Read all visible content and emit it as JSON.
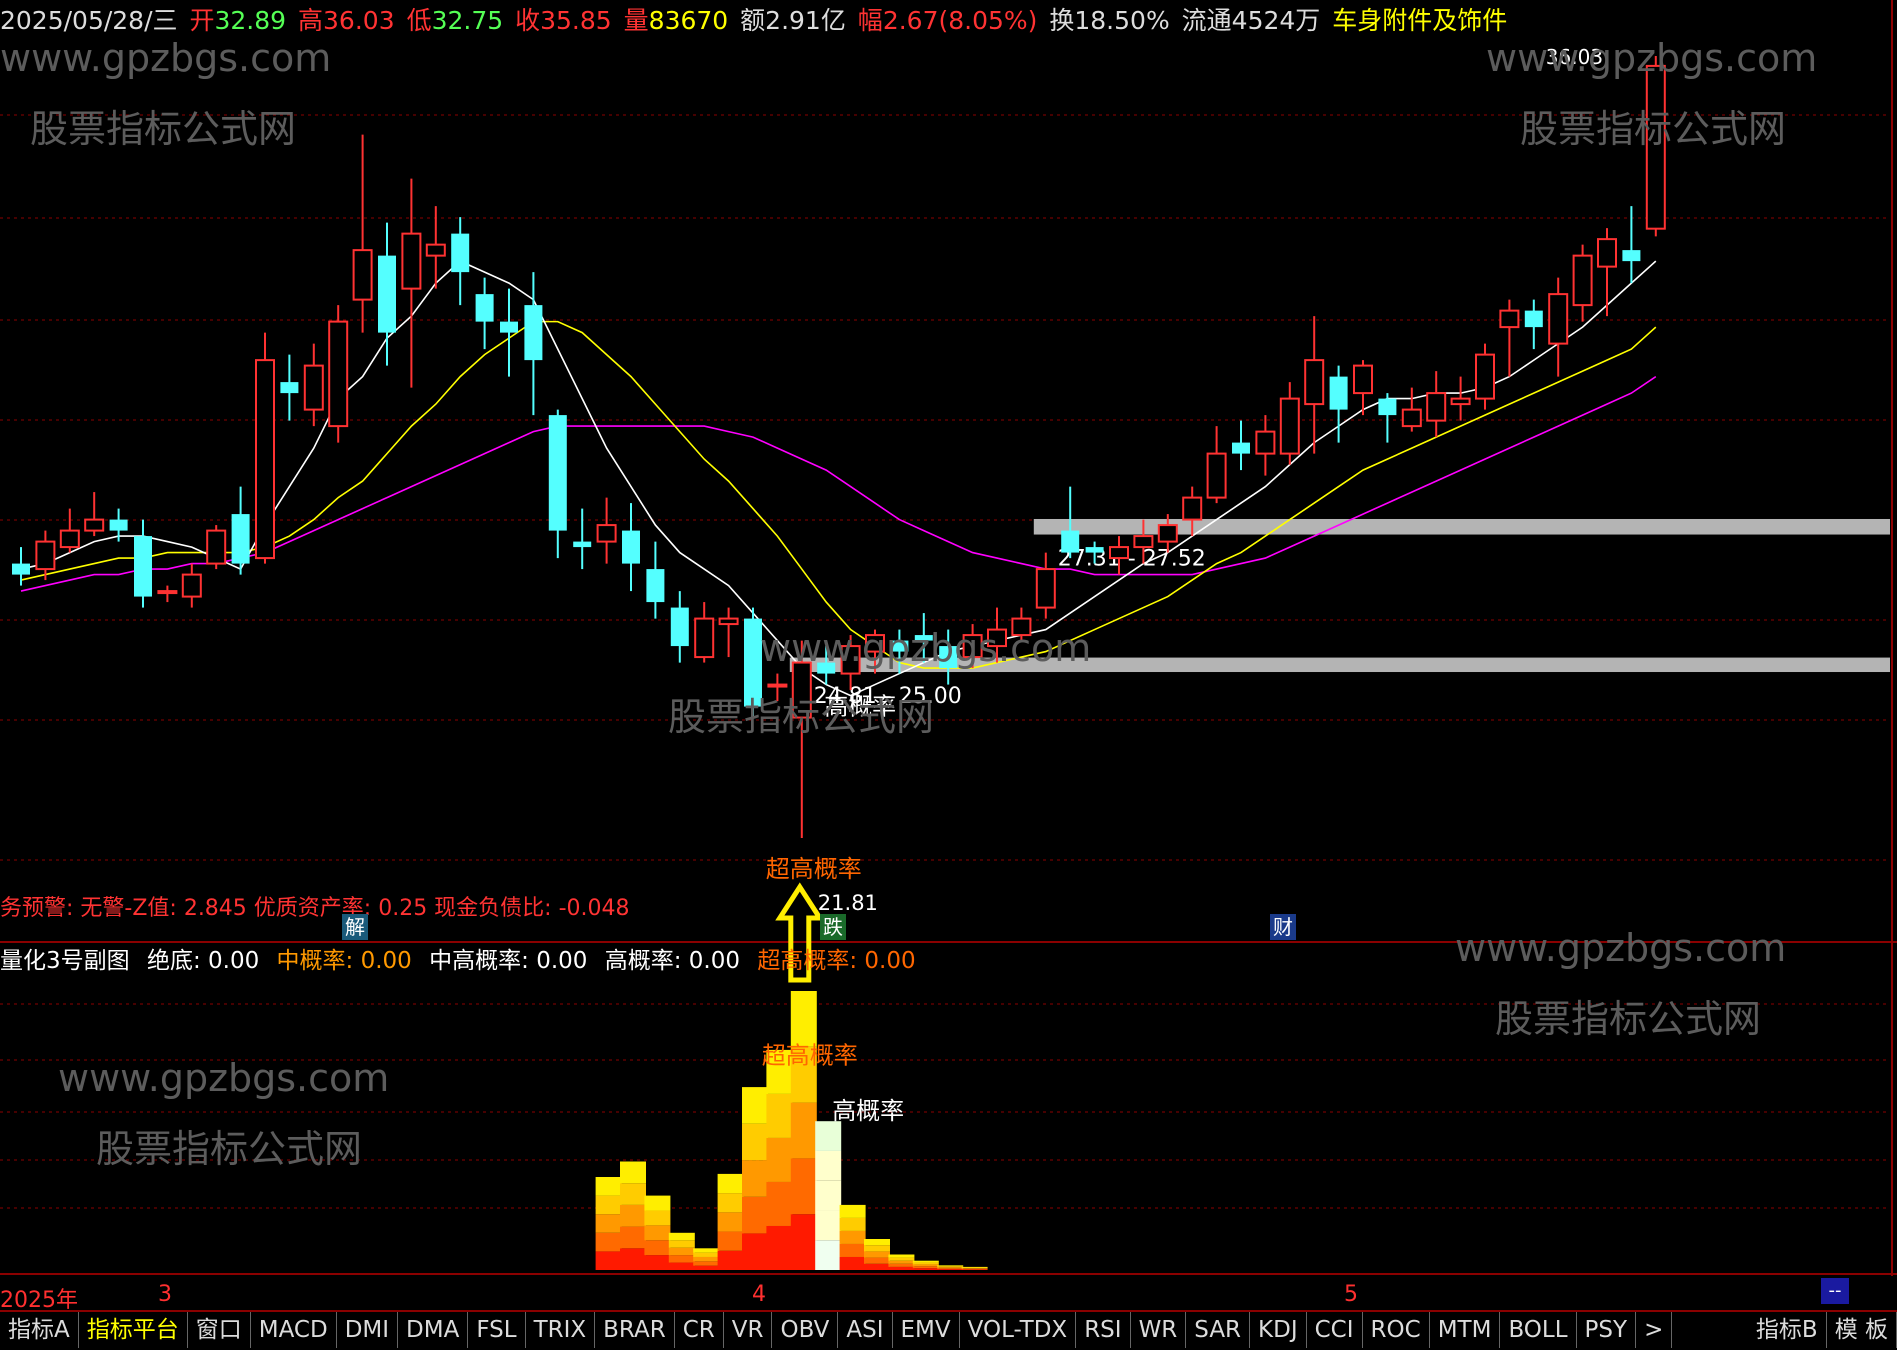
{
  "info_bar": {
    "date": "2025/05/28/三",
    "open_label": "开",
    "open": "32.89",
    "high_label": "高",
    "high": "36.03",
    "low_label": "低",
    "low": "32.75",
    "close_label": "收",
    "close": "35.85",
    "volume_label": "量",
    "volume": "83670",
    "amount_label": "额",
    "amount": "2.91亿",
    "change_label": "幅",
    "change": "2.67(8.05%)",
    "turnover_label": "换",
    "turnover": "18.50%",
    "float_label": "流通",
    "float": "4524万",
    "sector": "车身附件及饰件"
  },
  "alert_text": "务预警: 无警-Z值: 2.845 优质资产率: 0.25 现金负债比: -0.048",
  "tags": [
    {
      "label": "解",
      "color": "#1a5a7a"
    },
    {
      "label": "跌",
      "color": "#1a6a2a"
    },
    {
      "label": "财",
      "color": "#1a3a8a"
    }
  ],
  "sub_header": {
    "name": "量化3号副图",
    "items": [
      {
        "label": "绝底: 0.00",
        "color": "#ffffff"
      },
      {
        "label": "中概率: 0.00",
        "color": "#ff9900"
      },
      {
        "label": "中高概率: 0.00",
        "color": "#ffffff"
      },
      {
        "label": "高概率: 0.00",
        "color": "#ffffff"
      },
      {
        "label": "超高概率: 0.00",
        "color": "#ff6600"
      }
    ]
  },
  "watermarks": {
    "url": "www.gpzbgs.com",
    "name": "股票指标公式网"
  },
  "date_axis": [
    {
      "label": "2025年"
    },
    {
      "label": "3"
    },
    {
      "label": "4"
    },
    {
      "label": "5"
    }
  ],
  "tabs": [
    "指标A",
    "指标平台",
    "窗口",
    "MACD",
    "DMI",
    "DMA",
    "FSL",
    "TRIX",
    "BRAR",
    "CR",
    "VR",
    "OBV",
    "ASI",
    "EMV",
    "VOL-TDX",
    "RSI",
    "WR",
    "SAR",
    "KDJ",
    "CCI",
    "ROC",
    "MTM",
    "BOLL",
    "PSY",
    ">"
  ],
  "tabs_right": [
    "指标B",
    "模 板"
  ],
  "dash_label": "--",
  "colors": {
    "up": "#ff3232",
    "down": "#54ffff",
    "ma5": "#ffffff",
    "ma10": "#ffff00",
    "ma20": "#ff00ff",
    "zone": "#b4b4b4"
  },
  "chart_data": {
    "type": "candlestick",
    "price_axis": {
      "low": 21.81,
      "high": 36.03
    },
    "candles": [
      [
        26.8,
        26.6,
        27.1,
        26.4
      ],
      [
        26.7,
        27.2,
        27.4,
        26.5
      ],
      [
        27.1,
        27.4,
        27.8,
        27.0
      ],
      [
        27.4,
        27.6,
        28.1,
        27.3
      ],
      [
        27.6,
        27.4,
        27.8,
        27.2
      ],
      [
        27.3,
        26.2,
        27.6,
        26.0
      ],
      [
        26.3,
        26.3,
        26.4,
        26.1
      ],
      [
        26.2,
        26.6,
        26.8,
        26.0
      ],
      [
        26.8,
        27.4,
        27.5,
        26.7
      ],
      [
        27.7,
        26.8,
        28.2,
        26.6
      ],
      [
        26.9,
        30.5,
        31.0,
        26.8
      ],
      [
        30.1,
        29.9,
        30.6,
        29.4
      ],
      [
        29.6,
        30.4,
        30.8,
        29.3
      ],
      [
        29.3,
        31.2,
        31.5,
        29.0
      ],
      [
        31.6,
        32.5,
        34.6,
        31.0
      ],
      [
        32.4,
        31.0,
        33.0,
        30.4
      ],
      [
        31.8,
        32.8,
        33.8,
        30.0
      ],
      [
        32.4,
        32.6,
        33.3,
        31.8
      ],
      [
        32.8,
        32.1,
        33.1,
        31.5
      ],
      [
        31.7,
        31.2,
        32.0,
        30.7
      ],
      [
        31.2,
        31.0,
        31.8,
        30.2
      ],
      [
        31.5,
        30.5,
        32.1,
        29.5
      ],
      [
        29.5,
        27.4,
        29.6,
        26.9
      ],
      [
        27.2,
        27.1,
        27.8,
        26.7
      ],
      [
        27.2,
        27.5,
        28.0,
        26.8
      ],
      [
        27.4,
        26.8,
        27.9,
        26.3
      ],
      [
        26.7,
        26.1,
        27.2,
        25.8
      ],
      [
        26.0,
        25.3,
        26.3,
        25.0
      ],
      [
        25.1,
        25.8,
        26.1,
        25.0
      ],
      [
        25.7,
        25.8,
        26.0,
        25.1
      ],
      [
        25.8,
        24.2,
        26.0,
        24.0
      ],
      [
        24.6,
        24.6,
        24.8,
        24.3
      ],
      [
        24.0,
        25.0,
        25.4,
        21.81
      ],
      [
        25.0,
        24.8,
        25.3,
        24.6
      ],
      [
        24.8,
        25.3,
        25.5,
        24.5
      ],
      [
        25.2,
        25.5,
        25.6,
        24.8
      ],
      [
        25.4,
        25.2,
        25.6,
        24.8
      ],
      [
        25.5,
        25.4,
        25.9,
        25.0
      ],
      [
        25.3,
        24.9,
        25.6,
        24.6
      ],
      [
        25.1,
        25.5,
        25.7,
        24.9
      ],
      [
        25.3,
        25.6,
        26.0,
        25.0
      ],
      [
        25.5,
        25.8,
        26.0,
        25.4
      ],
      [
        26.0,
        26.7,
        27.0,
        25.8
      ],
      [
        27.4,
        27.0,
        28.2,
        26.9
      ],
      [
        27.1,
        27.0,
        27.2,
        26.8
      ],
      [
        26.9,
        27.1,
        27.3,
        26.6
      ],
      [
        27.1,
        27.3,
        27.6,
        26.8
      ],
      [
        27.2,
        27.5,
        27.7,
        27.0
      ],
      [
        27.6,
        28.0,
        28.2,
        27.3
      ],
      [
        28.0,
        28.8,
        29.3,
        27.9
      ],
      [
        29.0,
        28.8,
        29.4,
        28.5
      ],
      [
        28.8,
        29.2,
        29.5,
        28.4
      ],
      [
        28.8,
        29.8,
        30.1,
        28.6
      ],
      [
        29.7,
        30.5,
        31.3,
        28.8
      ],
      [
        30.2,
        29.6,
        30.4,
        29.0
      ],
      [
        29.9,
        30.4,
        30.5,
        29.5
      ],
      [
        29.8,
        29.5,
        29.9,
        29.0
      ],
      [
        29.3,
        29.6,
        30.0,
        29.2
      ],
      [
        29.4,
        29.9,
        30.3,
        29.1
      ],
      [
        29.7,
        29.8,
        30.2,
        29.4
      ],
      [
        29.8,
        30.6,
        30.8,
        29.6
      ],
      [
        31.1,
        31.4,
        31.6,
        30.2
      ],
      [
        31.4,
        31.1,
        31.6,
        30.7
      ],
      [
        30.8,
        31.7,
        32.0,
        30.2
      ],
      [
        31.5,
        32.4,
        32.6,
        31.2
      ],
      [
        32.2,
        32.7,
        32.9,
        31.3
      ],
      [
        32.5,
        32.3,
        33.3,
        31.9
      ],
      [
        32.89,
        35.85,
        36.03,
        32.75
      ]
    ],
    "ma5": [
      26.7,
      26.8,
      27.0,
      27.2,
      27.3,
      27.3,
      27.2,
      27.1,
      26.9,
      26.7,
      27.5,
      28.2,
      28.9,
      29.8,
      30.2,
      30.9,
      31.3,
      31.9,
      32.3,
      32.1,
      31.9,
      31.6,
      30.7,
      29.8,
      28.9,
      28.2,
      27.5,
      27.0,
      26.7,
      26.4,
      25.9,
      25.4,
      24.9,
      24.6,
      24.4,
      24.6,
      24.8,
      25.0,
      25.2,
      25.3,
      25.4,
      25.5,
      25.6,
      25.9,
      26.2,
      26.5,
      26.8,
      27.0,
      27.3,
      27.6,
      27.9,
      28.2,
      28.6,
      29.0,
      29.3,
      29.6,
      29.8,
      29.8,
      29.9,
      29.9,
      30.0,
      30.2,
      30.5,
      30.8,
      31.1,
      31.5,
      31.9,
      32.3
    ],
    "ma10": [
      26.5,
      26.6,
      26.7,
      26.8,
      26.9,
      26.9,
      27.0,
      27.0,
      27.0,
      27.0,
      27.1,
      27.3,
      27.6,
      28.0,
      28.3,
      28.8,
      29.3,
      29.7,
      30.2,
      30.6,
      30.9,
      31.2,
      31.2,
      31.0,
      30.6,
      30.2,
      29.7,
      29.2,
      28.7,
      28.3,
      27.8,
      27.3,
      26.7,
      26.1,
      25.6,
      25.3,
      25.0,
      24.9,
      24.9,
      24.9,
      25.0,
      25.1,
      25.2,
      25.4,
      25.6,
      25.8,
      26.0,
      26.2,
      26.5,
      26.8,
      27.0,
      27.3,
      27.6,
      27.9,
      28.2,
      28.5,
      28.7,
      28.9,
      29.1,
      29.3,
      29.5,
      29.7,
      29.9,
      30.1,
      30.3,
      30.5,
      30.7,
      31.1
    ],
    "ma20": [
      26.3,
      26.4,
      26.5,
      26.6,
      26.6,
      26.7,
      26.7,
      26.8,
      26.8,
      26.9,
      27.0,
      27.2,
      27.4,
      27.6,
      27.8,
      28.0,
      28.2,
      28.4,
      28.6,
      28.8,
      29.0,
      29.2,
      29.3,
      29.3,
      29.3,
      29.3,
      29.3,
      29.3,
      29.3,
      29.2,
      29.1,
      28.9,
      28.7,
      28.5,
      28.2,
      27.9,
      27.6,
      27.4,
      27.2,
      27.0,
      26.9,
      26.8,
      26.7,
      26.7,
      26.6,
      26.6,
      26.6,
      26.6,
      26.6,
      26.7,
      26.8,
      26.9,
      27.1,
      27.3,
      27.5,
      27.7,
      27.9,
      28.1,
      28.3,
      28.5,
      28.7,
      28.9,
      29.1,
      29.3,
      29.5,
      29.7,
      29.9,
      30.2
    ],
    "zones": [
      {
        "low": 27.31,
        "high": 27.52,
        "label": "27.31 - 27.52",
        "start": 42
      },
      {
        "low": 24.81,
        "high": 25.0,
        "label": "24.81 - 25.00",
        "start": 32
      }
    ],
    "annotations": [
      {
        "index": 33,
        "price": 24.6,
        "label": "高概率",
        "color": "#ffffff"
      },
      {
        "index": 32,
        "price": 22.3,
        "label": "超高概率",
        "color": "#ff6600"
      },
      {
        "index": 32,
        "price": 21.81,
        "label": "21.81",
        "color": "#ffffff"
      },
      {
        "index": 67,
        "price": 36.03,
        "label": "36.03",
        "color": "#ffffff"
      }
    ],
    "sub_bars": [
      {
        "index": 24,
        "value": 3.0
      },
      {
        "index": 25,
        "value": 3.5
      },
      {
        "index": 26,
        "value": 2.4
      },
      {
        "index": 27,
        "value": 1.2
      },
      {
        "index": 28,
        "value": 0.7
      },
      {
        "index": 29,
        "value": 3.1
      },
      {
        "index": 30,
        "value": 5.9
      },
      {
        "index": 31,
        "value": 7.1
      },
      {
        "index": 32,
        "value": 9.0
      },
      {
        "index": 33,
        "value": 4.8
      },
      {
        "index": 34,
        "value": 2.1
      },
      {
        "index": 35,
        "value": 1.0
      },
      {
        "index": 36,
        "value": 0.5
      },
      {
        "index": 37,
        "value": 0.3
      },
      {
        "index": 38,
        "value": 0.15
      },
      {
        "index": 39,
        "value": 0.1
      }
    ],
    "sub_annotations": [
      {
        "index": 32,
        "value": 6.6,
        "label": "超高概率",
        "color": "#ff6600"
      },
      {
        "index": 33,
        "value": 4.8,
        "label": "高概率",
        "color": "#ffffff"
      }
    ]
  }
}
